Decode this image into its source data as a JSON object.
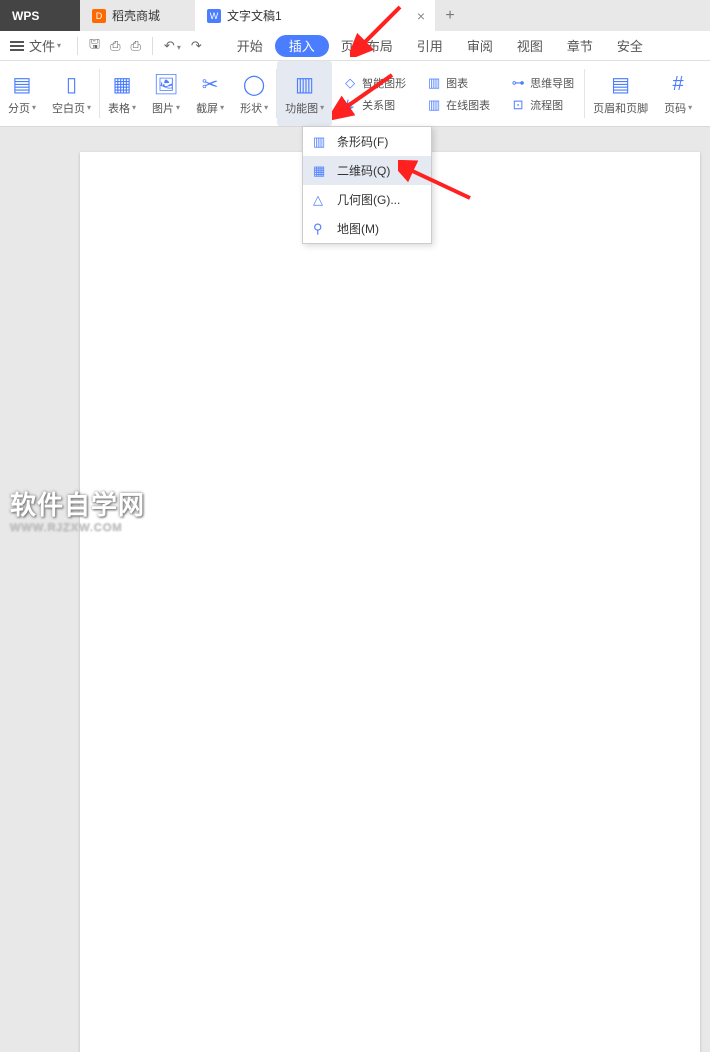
{
  "titlebar": {
    "wps": "WPS",
    "store": "稻壳商城",
    "doc": "文字文稿1",
    "close_glyph": "×",
    "add_glyph": "+",
    "blue_glyph": "W"
  },
  "menubar": {
    "file": "文件",
    "tabs": [
      "开始",
      "插入",
      "页面布局",
      "引用",
      "审阅",
      "视图",
      "章节",
      "安全"
    ]
  },
  "ribbon": {
    "page_split": "分页",
    "blank_page": "空白页",
    "table": "表格",
    "picture": "图片",
    "screenshot": "截屏",
    "shapes": "形状",
    "func_chart": "功能图",
    "smart_graphic": "智能图形",
    "chart": "图表",
    "relation": "关系图",
    "online_chart": "在线图表",
    "mindmap": "思维导图",
    "flowchart": "流程图",
    "header_footer": "页眉和页脚",
    "page_number": "页码"
  },
  "dropdown": {
    "barcode": "条形码(F)",
    "qrcode": "二维码(Q)",
    "geometry": "几何图(G)...",
    "map": "地图(M)"
  },
  "watermark": {
    "main": "软件自学网",
    "sub": "WWW.RJZXW.COM"
  }
}
